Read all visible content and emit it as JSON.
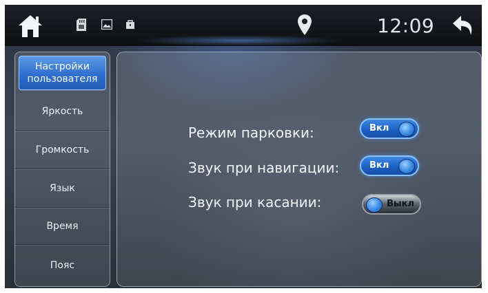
{
  "statusbar": {
    "time": "12:09",
    "icons": [
      "home-icon",
      "sd-card-icon",
      "image-icon",
      "bag-icon",
      "location-pin-icon",
      "back-arrow-icon"
    ]
  },
  "sidebar": {
    "items": [
      {
        "label": "Настройки пользователя",
        "active": true
      },
      {
        "label": "Яркость",
        "active": false
      },
      {
        "label": "Громкость",
        "active": false
      },
      {
        "label": "Язык",
        "active": false
      },
      {
        "label": "Время",
        "active": false
      },
      {
        "label": "Пояс",
        "active": false
      }
    ]
  },
  "settings": {
    "rows": [
      {
        "label": "Режим парковки:",
        "toggle": "Вкл",
        "state": "on"
      },
      {
        "label": "Звук при навигации:",
        "toggle": "Вкл",
        "state": "on"
      },
      {
        "label": "Звук при касании:",
        "toggle": "Выкл",
        "state": "off"
      }
    ]
  },
  "colors": {
    "accent": "#2f6fcf",
    "toggle_on": "#1b5dc2",
    "toggle_off": "#5e6570",
    "text": "#f2f4f7"
  }
}
